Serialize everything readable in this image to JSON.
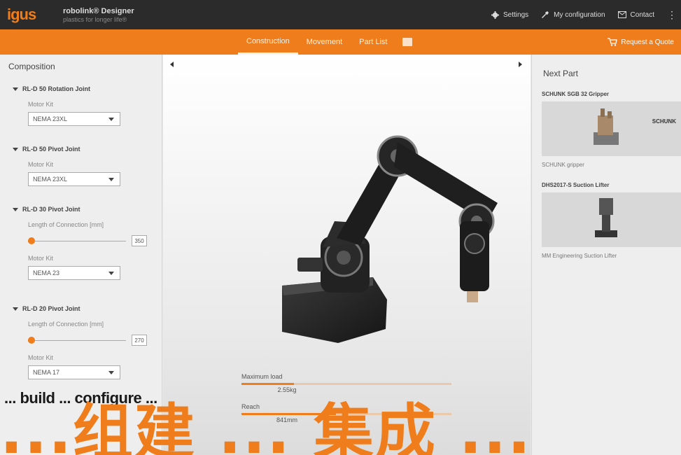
{
  "brand": {
    "logo": "igus",
    "product_name": "robolink® Designer",
    "tagline": "plastics for longer life®",
    "accent": "#f07d1b"
  },
  "topnav": {
    "settings": "Settings",
    "my_configuration": "My configuration",
    "contact": "Contact"
  },
  "tabs": [
    {
      "label": "Construction",
      "active": true
    },
    {
      "label": "Movement",
      "active": false
    },
    {
      "label": "Part List",
      "active": false
    }
  ],
  "pdf_icon": "pdf-icon",
  "request_quote": "Request a Quote",
  "composition": {
    "title": "Composition",
    "sections": [
      {
        "name": "RL-D 50 Rotation Joint",
        "motor_label": "Motor Kit",
        "motor_value": "NEMA 23XL"
      },
      {
        "name": "RL-D 50 Pivot Joint",
        "motor_label": "Motor Kit",
        "motor_value": "NEMA 23XL"
      },
      {
        "name": "RL-D 30 Pivot Joint",
        "length_label": "Length of Connection [mm]",
        "length_value": "350",
        "length_fraction": 0.0,
        "motor_label": "Motor Kit",
        "motor_value": "NEMA 23"
      },
      {
        "name": "RL-D 20 Pivot Joint",
        "length_label": "Length of Connection [mm]",
        "length_value": "270",
        "length_fraction": 0.0,
        "motor_label": "Motor Kit",
        "motor_value": "NEMA 17"
      }
    ]
  },
  "stats": [
    {
      "label": "Maximum load",
      "value": "2.55kg",
      "fraction": 0.25
    },
    {
      "label": "Reach",
      "value": "841mm",
      "fraction": 0.45
    }
  ],
  "next_part": {
    "title": "Next Part",
    "items": [
      {
        "name": "SCHUNK SGB 32 Gripper",
        "description": "SCHUNK gripper",
        "brand": "SCHUNK"
      },
      {
        "name": "DHS2017-S Suction Lifter",
        "description": "MM Engineering Suction Lifter"
      }
    ]
  },
  "captions": {
    "english": "... build ... configure ...",
    "chinese": "...组建 ... 集成 ..."
  }
}
